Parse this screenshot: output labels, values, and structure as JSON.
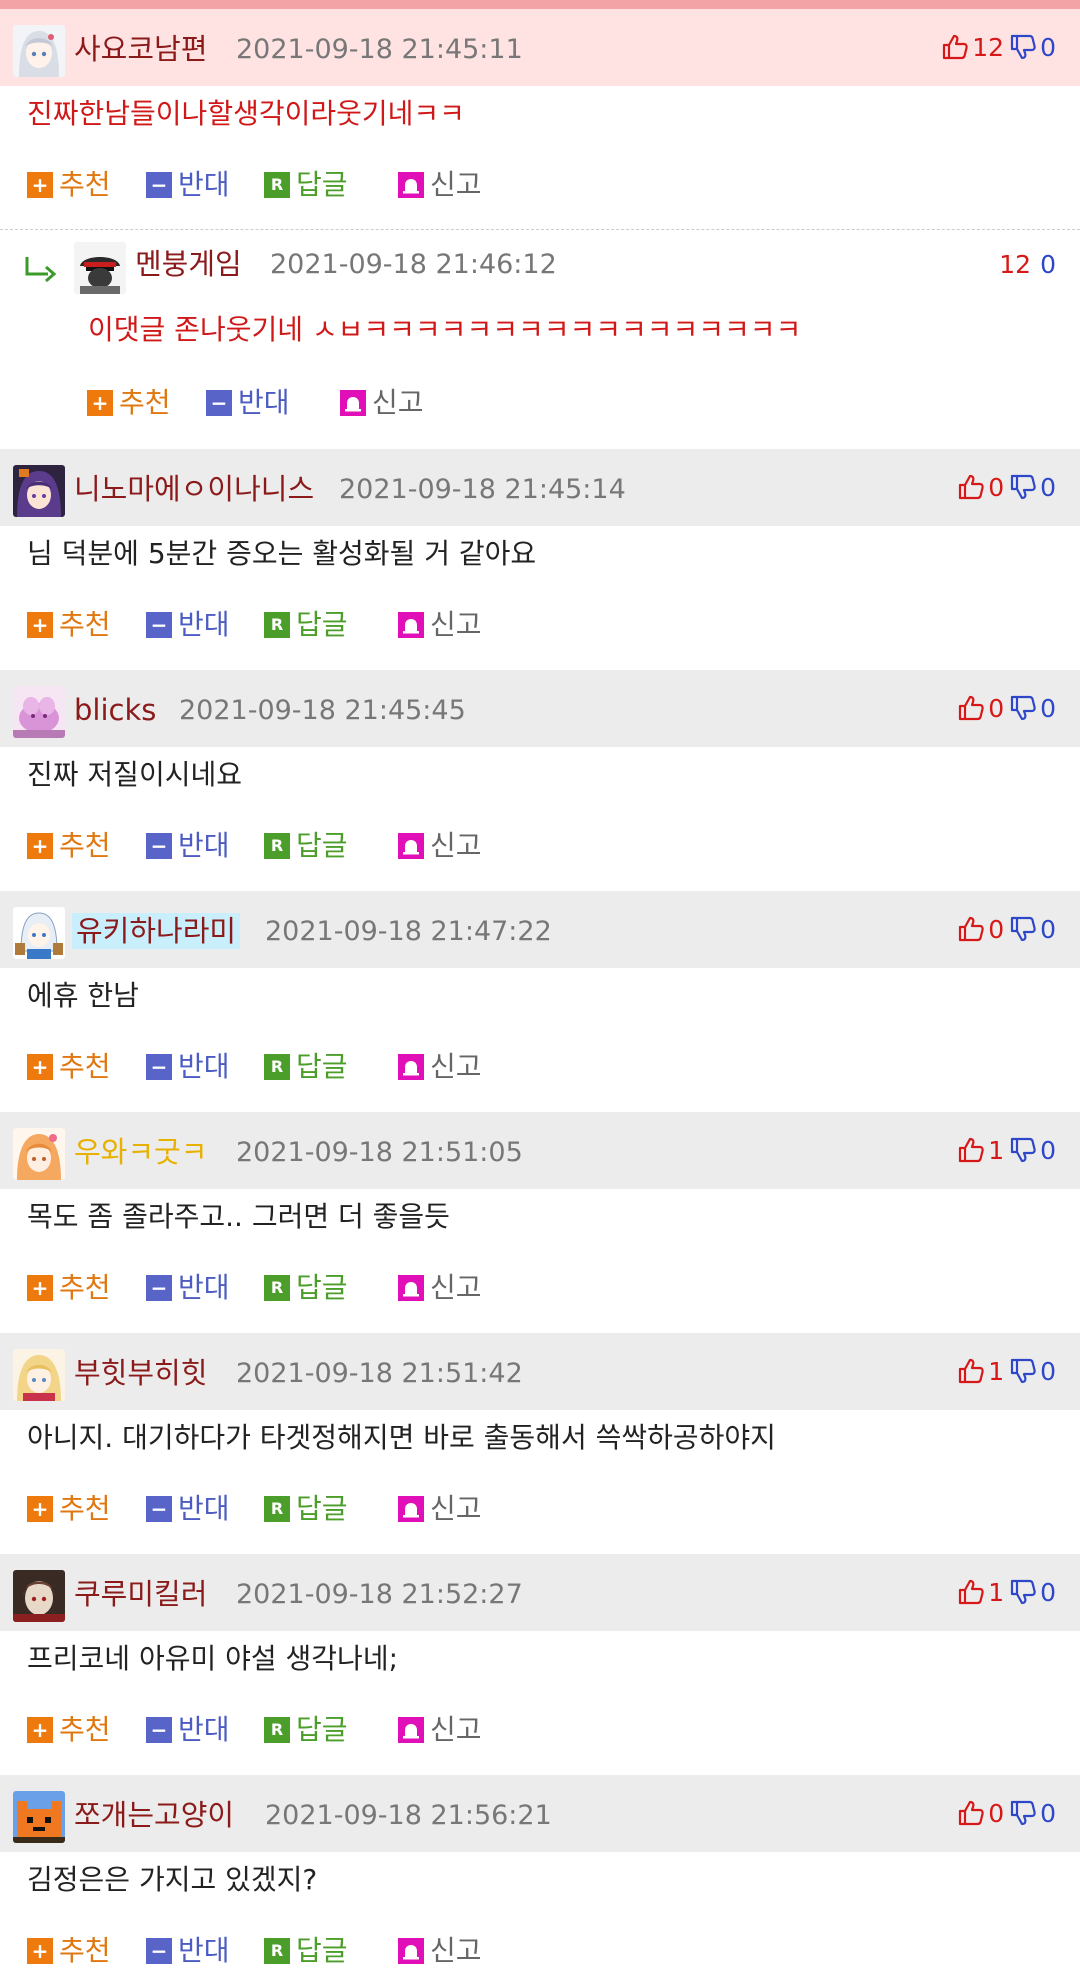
{
  "comments": [
    {
      "kind": "best",
      "nickname": "사요코남편",
      "date": "2021-09-18 21:45:11",
      "text": "진짜한남들이나할생각이라웃기네ㅋㅋ",
      "text_color": "#d01818",
      "up": "12",
      "down": "0",
      "avatar": "silver-hair-girl",
      "show_reply": true
    },
    {
      "kind": "reply",
      "nickname": "멘붕게임",
      "date": "2021-09-18 21:46:12",
      "text": "이댓글 존나웃기네 ㅅㅂㅋㅋㅋㅋㅋㅋㅋㅋㅋㅋㅋㅋㅋㅋㅋㅋㅋ",
      "text_color": "#d01818",
      "up": "12",
      "down": "0",
      "avatar": "officer-cap",
      "show_reply": false
    },
    {
      "kind": "normal",
      "nickname": "니노마에ㅇ이나니스",
      "date": "2021-09-18 21:45:14",
      "text": "님 덕분에 5분간 증오는 활성화될 거 같아요",
      "up": "0",
      "down": "0",
      "avatar": "purple-hair-girl",
      "show_reply": true
    },
    {
      "kind": "normal",
      "nickname": "blicks",
      "date": "2021-09-18 21:45:45",
      "text": "진짜 저질이시네요",
      "up": "0",
      "down": "0",
      "avatar": "pink-creature",
      "show_reply": true
    },
    {
      "kind": "normal",
      "nickname": "유키하나라미",
      "date": "2021-09-18 21:47:22",
      "text": "에휴 한남",
      "up": "0",
      "down": "0",
      "avatar": "white-hair-chibi",
      "show_reply": true
    },
    {
      "kind": "normal",
      "nickname": "우와ㅋ굿ㅋ",
      "date": "2021-09-18 21:51:05",
      "text": "목도 좀 졸라주고.. 그러면 더 좋을듯",
      "up": "1",
      "down": "0",
      "avatar": "orange-hair-girl",
      "show_reply": true
    },
    {
      "kind": "normal",
      "nickname": "부힛부히힛",
      "date": "2021-09-18 21:51:42",
      "text": "아니지. 대기하다가 타겟정해지면 바로 출동해서 쓱싹하공하야지",
      "up": "1",
      "down": "0",
      "avatar": "blonde-girl",
      "show_reply": true
    },
    {
      "kind": "normal",
      "nickname": "쿠루미킬러",
      "date": "2021-09-18 21:52:27",
      "text": "프리코네 아유미 야설 생각나네;",
      "up": "1",
      "down": "0",
      "avatar": "dark-figure",
      "show_reply": true
    },
    {
      "kind": "normal",
      "nickname": "쪼개는고양이",
      "date": "2021-09-18 21:56:21",
      "text": "김정은은 가지고 있겠지?",
      "up": "0",
      "down": "0",
      "avatar": "orange-pixel-cat",
      "show_reply": true
    }
  ],
  "actions": {
    "recommend": "추천",
    "oppose": "반대",
    "reply": "답글",
    "report": "신고",
    "reply_icon_letter": "R"
  },
  "colors": {
    "nickname": "#8b1a1a",
    "nickname_gold": "#e8b000",
    "up_count": "#d71818",
    "down_count": "#2d47c8",
    "best_header_bg": "#ffe3e3",
    "header_bg": "#ececec"
  }
}
